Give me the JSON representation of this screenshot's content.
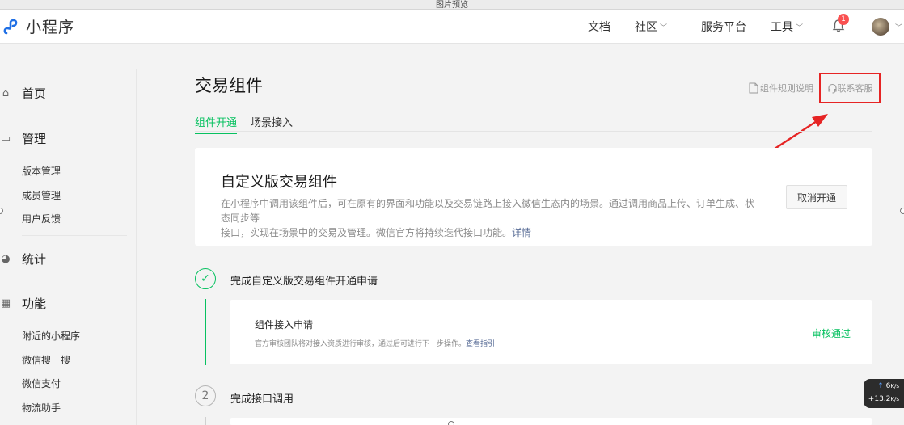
{
  "window": {
    "title": "图片预览"
  },
  "header": {
    "logo_text": "小程序",
    "nav": [
      {
        "label": "文档",
        "dropdown": false
      },
      {
        "label": "社区",
        "dropdown": true
      },
      {
        "label": "服务平台",
        "dropdown": false
      },
      {
        "label": "工具",
        "dropdown": true
      }
    ],
    "notification_count": "1"
  },
  "sidebar": {
    "home": "首页",
    "manage": {
      "label": "管理",
      "items": [
        "版本管理",
        "成员管理",
        "用户反馈"
      ]
    },
    "stats": "统计",
    "features": {
      "label": "功能",
      "items": [
        "附近的小程序",
        "微信搜一搜",
        "微信支付",
        "物流助手"
      ]
    }
  },
  "page": {
    "title": "交易组件",
    "doc_link": "组件规则说明",
    "contact_link": "联系客服",
    "tabs": [
      "组件开通",
      "场景接入"
    ],
    "active_tab": 0
  },
  "intro_card": {
    "title": "自定义版交易组件",
    "desc_line1": "在小程序中调用该组件后，可在原有的界面和功能以及交易链路上接入微信生态内的场景。通过调用商品上传、订单生成、状态同步等",
    "desc_line2": "接口，实现在场景中的交易及管理。微信官方将持续迭代接口功能。",
    "detail_link": "详情",
    "cancel_button": "取消开通"
  },
  "steps": [
    {
      "number": "✓",
      "title": "完成自定义版交易组件开通申请",
      "sub": {
        "title": "组件接入申请",
        "desc": "官方审核团队将对接入资质进行审核，通过后可进行下一步操作。",
        "guide_link": "查看指引",
        "status": "审核通过"
      }
    },
    {
      "number": "2",
      "title": "完成接口调用"
    }
  ],
  "net_speed": {
    "up": "6",
    "up_unit": "K/s",
    "down": "+13.2",
    "down_unit": "K/s"
  },
  "colors": {
    "brand_green": "#07c160",
    "link_blue": "#576b95",
    "highlight_red": "#e62424",
    "badge_red": "#fa5151"
  }
}
